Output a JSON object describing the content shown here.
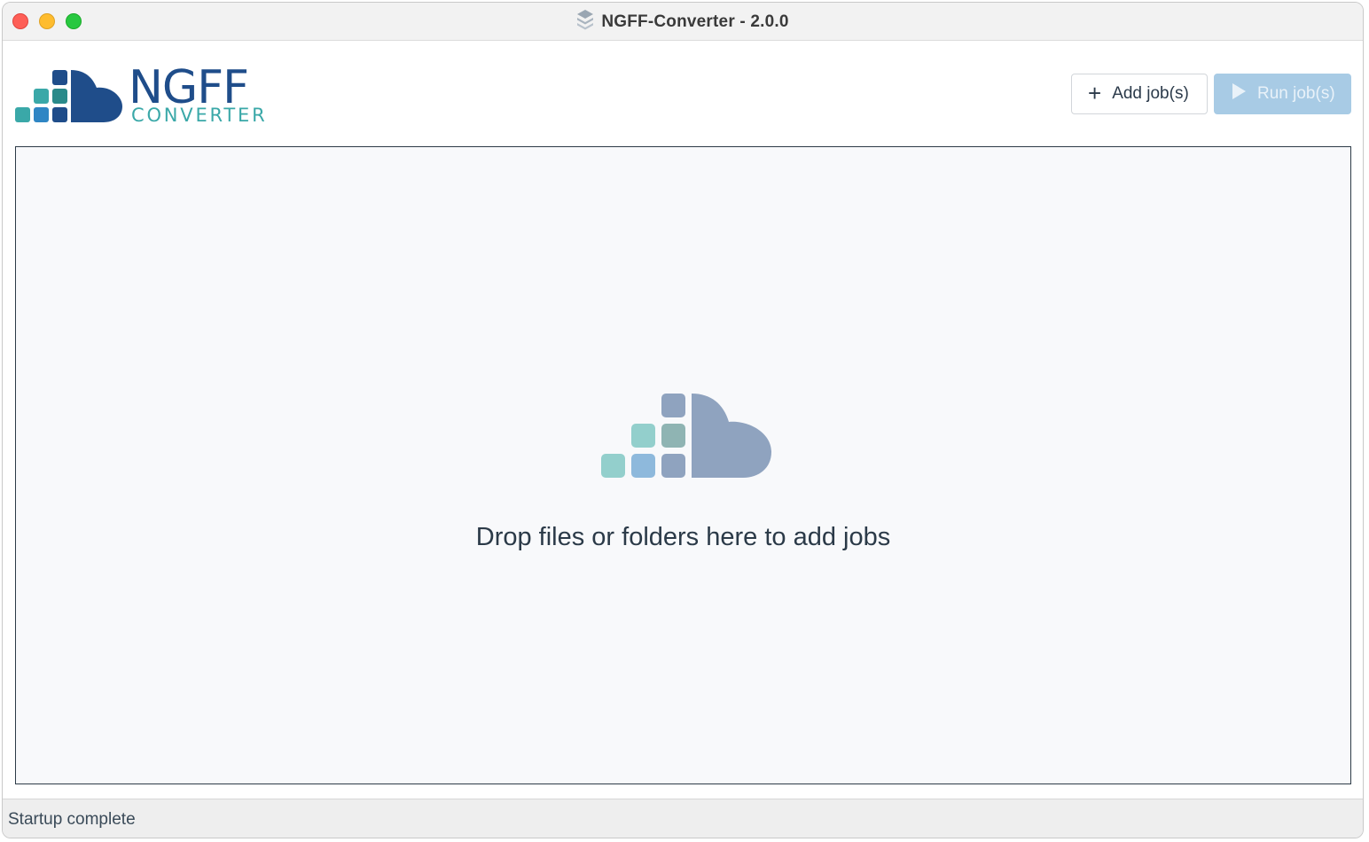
{
  "window": {
    "title": "NGFF-Converter - 2.0.0"
  },
  "logo": {
    "name": "NGFF",
    "subtitle": "CONVERTER",
    "colors": {
      "navy": "#1f4d8a",
      "teal": "#3aa8a8",
      "blue": "#2f86c4"
    }
  },
  "toolbar": {
    "add_label": "Add job(s)",
    "add_icon": "plus-icon",
    "run_label": "Run job(s)",
    "run_icon": "play-icon",
    "run_enabled": false
  },
  "dropzone": {
    "message": "Drop files or folders here to add jobs",
    "icon": "ngff-cloud-icon",
    "colors": {
      "slate": "#8fa3bf",
      "teal": "#93cfcc",
      "blue": "#8eb9dc",
      "gray_teal": "#8fb4b3"
    }
  },
  "status": {
    "text": "Startup complete"
  },
  "colors": {
    "accent": "#a8cbe5",
    "border": "#2d3b47",
    "text": "#2b3a48"
  }
}
